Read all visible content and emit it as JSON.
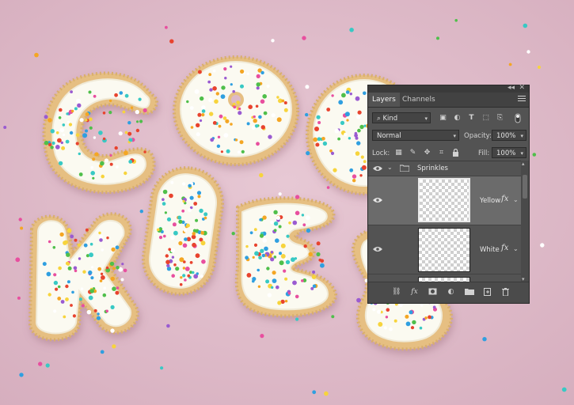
{
  "panel": {
    "collapse_glyph": "◂◂",
    "close_glyph": "✕",
    "tabs": [
      {
        "label": "Layers",
        "active": true
      },
      {
        "label": "Channels",
        "active": false
      }
    ],
    "filter": {
      "kind_label": "Kind",
      "filter_icons": [
        "image-filter-icon",
        "adjustment-filter-icon",
        "type-filter-icon",
        "shape-filter-icon",
        "smart-object-filter-icon"
      ],
      "type_glyph": "T"
    },
    "blend_mode": "Normal",
    "opacity_label": "Opacity:",
    "opacity_value": "100%",
    "lock_label": "Lock:",
    "fill_label": "Fill:",
    "fill_value": "100%",
    "fx_glyph": "fx",
    "layers": [
      {
        "name": "Sprinkles",
        "type": "group",
        "visible": true
      },
      {
        "name": "Yellow",
        "type": "layer",
        "visible": true,
        "has_fx": true,
        "selected": true
      },
      {
        "name": "White",
        "type": "layer",
        "visible": true,
        "has_fx": true,
        "selected": false
      }
    ],
    "bottom_icons": [
      "link-icon",
      "fx-icon",
      "mask-icon",
      "adjustment-icon",
      "folder-icon",
      "new-layer-icon",
      "trash-icon"
    ]
  },
  "colors": {
    "canvas_background": "#ddb9c8",
    "icing": "#fbfaf2",
    "cookie_edge": "#e9c589",
    "panel_bg": "#535353",
    "selected_row": "#6b6b6b"
  }
}
